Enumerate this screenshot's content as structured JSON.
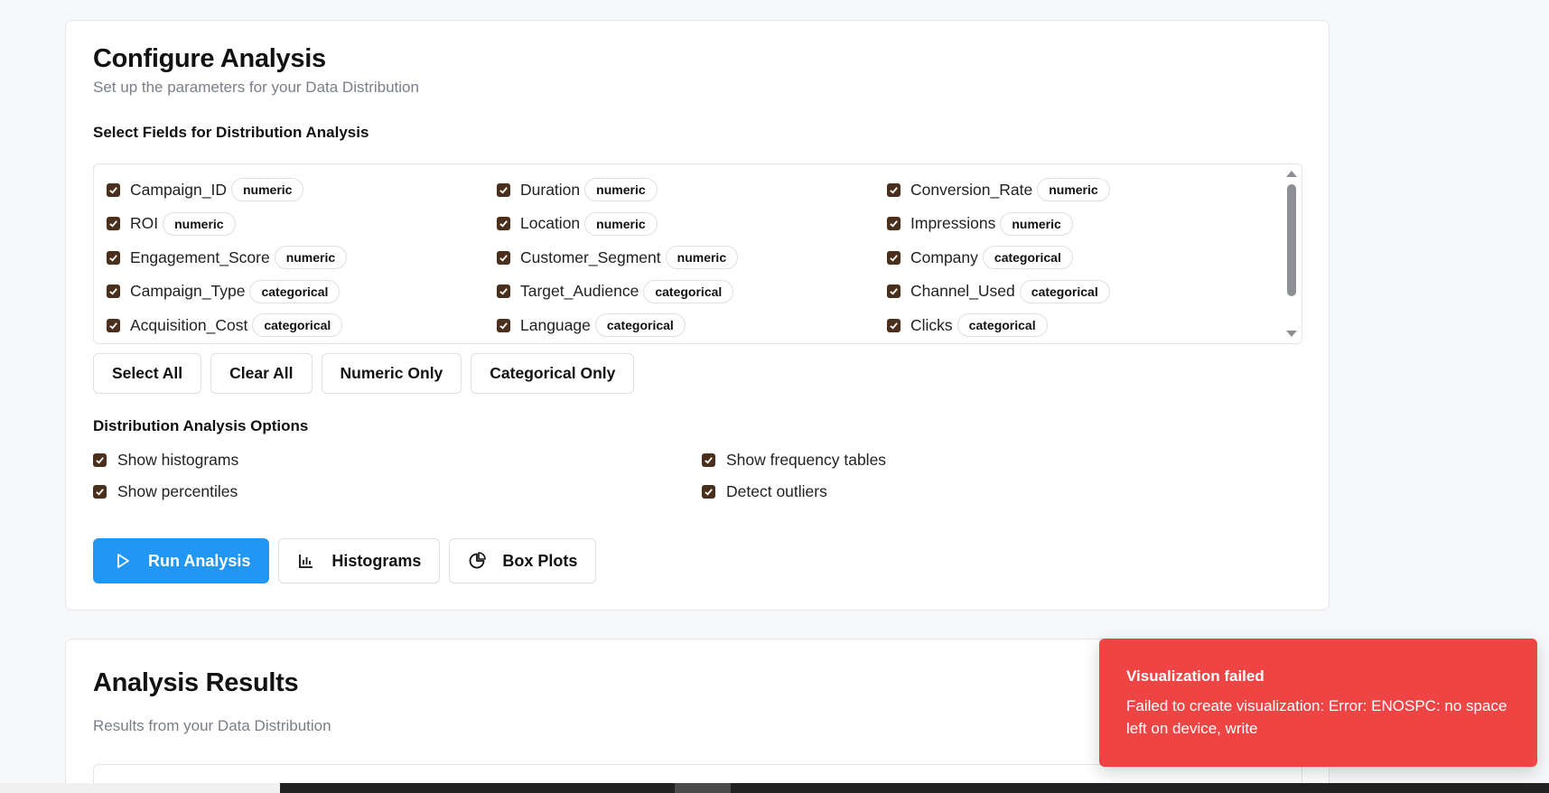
{
  "config": {
    "title": "Configure Analysis",
    "subtitle": "Set up the parameters for your Data Distribution",
    "fields_label": "Select Fields for Distribution Analysis",
    "fields": [
      {
        "name": "Campaign_ID",
        "type": "numeric",
        "checked": true
      },
      {
        "name": "Duration",
        "type": "numeric",
        "checked": true
      },
      {
        "name": "Conversion_Rate",
        "type": "numeric",
        "checked": true
      },
      {
        "name": "ROI",
        "type": "numeric",
        "checked": true
      },
      {
        "name": "Location",
        "type": "numeric",
        "checked": true
      },
      {
        "name": "Impressions",
        "type": "numeric",
        "checked": true
      },
      {
        "name": "Engagement_Score",
        "type": "numeric",
        "checked": true
      },
      {
        "name": "Customer_Segment",
        "type": "numeric",
        "checked": true
      },
      {
        "name": "Company",
        "type": "categorical",
        "checked": true
      },
      {
        "name": "Campaign_Type",
        "type": "categorical",
        "checked": true
      },
      {
        "name": "Target_Audience",
        "type": "categorical",
        "checked": true
      },
      {
        "name": "Channel_Used",
        "type": "categorical",
        "checked": true
      },
      {
        "name": "Acquisition_Cost",
        "type": "categorical",
        "checked": true
      },
      {
        "name": "Language",
        "type": "categorical",
        "checked": true
      },
      {
        "name": "Clicks",
        "type": "categorical",
        "checked": true
      }
    ],
    "buttons": {
      "select_all": "Select All",
      "clear_all": "Clear All",
      "numeric_only": "Numeric Only",
      "categorical_only": "Categorical Only"
    },
    "options_label": "Distribution Analysis Options",
    "options": {
      "histograms": "Show histograms",
      "frequency_tables": "Show frequency tables",
      "percentiles": "Show percentiles",
      "outliers": "Detect outliers"
    },
    "actions": {
      "run": "Run Analysis",
      "histograms": "Histograms",
      "box_plots": "Box Plots"
    }
  },
  "results": {
    "title": "Analysis Results",
    "subtitle": "Results from your Data Distribution"
  },
  "toast": {
    "title": "Visualization failed",
    "message": "Failed to create visualization: Error: ENOSPC: no space left on device, write"
  },
  "colors": {
    "primary": "#2196f3",
    "toast_bg": "#ef4444",
    "checkbox": "#4a2f1c"
  },
  "icons": {
    "run": "play-icon",
    "histograms": "bar-chart-icon",
    "box_plots": "pie-chart-icon"
  }
}
